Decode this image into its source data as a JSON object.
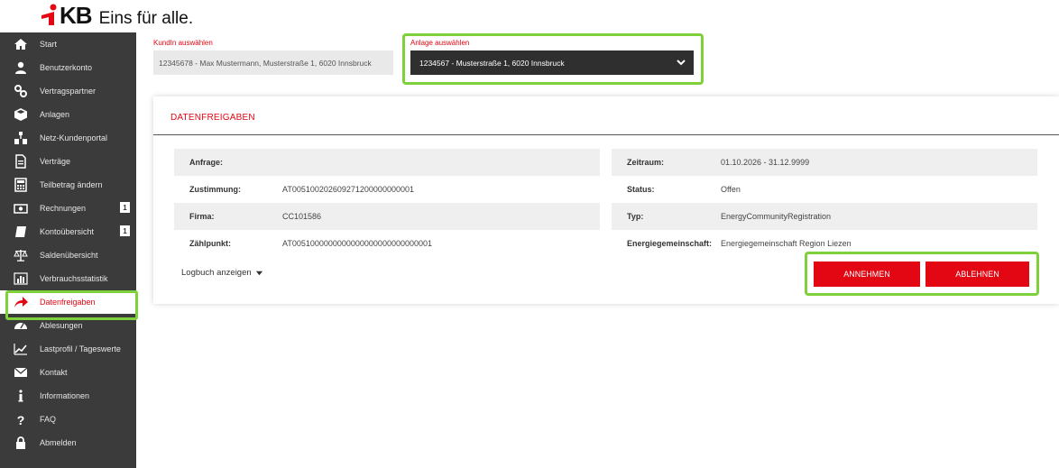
{
  "brand": {
    "logo_mark": "KB",
    "tagline": "Eins für alle."
  },
  "sidebar": {
    "items": [
      {
        "label": "Start",
        "icon": "home-icon"
      },
      {
        "label": "Benutzerkonto",
        "icon": "user-icon"
      },
      {
        "label": "Vertragspartner",
        "icon": "handshake-icon"
      },
      {
        "label": "Anlagen",
        "icon": "box-icon"
      },
      {
        "label": "Netz-Kundenportal",
        "icon": "network-icon"
      },
      {
        "label": "Verträge",
        "icon": "document-icon"
      },
      {
        "label": "Teilbetrag ändern",
        "icon": "calculator-icon"
      },
      {
        "label": "Rechnungen",
        "icon": "money-icon",
        "badge": "1"
      },
      {
        "label": "Kontoübersicht",
        "icon": "ledger-icon",
        "badge": "1"
      },
      {
        "label": "Saldenübersicht",
        "icon": "scale-icon"
      },
      {
        "label": "Verbrauchsstatistik",
        "icon": "bar-chart-icon"
      },
      {
        "label": "Datenfreigaben",
        "icon": "share-arrow-icon",
        "active": true
      },
      {
        "label": "Ablesungen",
        "icon": "gauge-icon"
      },
      {
        "label": "Lastprofil / Tageswerte",
        "icon": "line-chart-icon"
      },
      {
        "label": "Kontakt",
        "icon": "mail-icon"
      },
      {
        "label": "Informationen",
        "icon": "info-icon"
      },
      {
        "label": "FAQ",
        "icon": "question-icon"
      },
      {
        "label": "Abmelden",
        "icon": "lock-icon"
      }
    ]
  },
  "selection": {
    "kunde_label": "KundIn auswählen",
    "kunde_value": "12345678 - Max Mustermann, Musterstraße 1, 6020 Innsbruck",
    "anlage_label": "Anlage auswählen",
    "anlage_value": "1234567 - Musterstraße 1, 6020 Innsbruck"
  },
  "card": {
    "title": "DATENFREIGABEN",
    "left": [
      {
        "label": "Anfrage:",
        "value": ""
      },
      {
        "label": "Zustimmung:",
        "value": "AT005100202609271200000000001"
      },
      {
        "label": "Firma:",
        "value": "CC101586"
      },
      {
        "label": "Zählpunkt:",
        "value": "AT0051000000000000000000000000001"
      }
    ],
    "right": [
      {
        "label": "Zeitraum:",
        "value": "01.10.2026 - 31.12.9999"
      },
      {
        "label": "Status:",
        "value": "Offen"
      },
      {
        "label": "Typ:",
        "value": "EnergyCommunityRegistration"
      },
      {
        "label": "Energiegemeinschaft:",
        "value": "Energiegemeinschaft Region Liezen"
      }
    ],
    "logbuch_label": "Logbuch anzeigen",
    "accept_label": "ANNEHMEN",
    "reject_label": "ABLEHNEN"
  },
  "colors": {
    "accent": "#e30613",
    "sidebar_bg": "#3b3b3b",
    "highlight": "#7fd13b"
  }
}
